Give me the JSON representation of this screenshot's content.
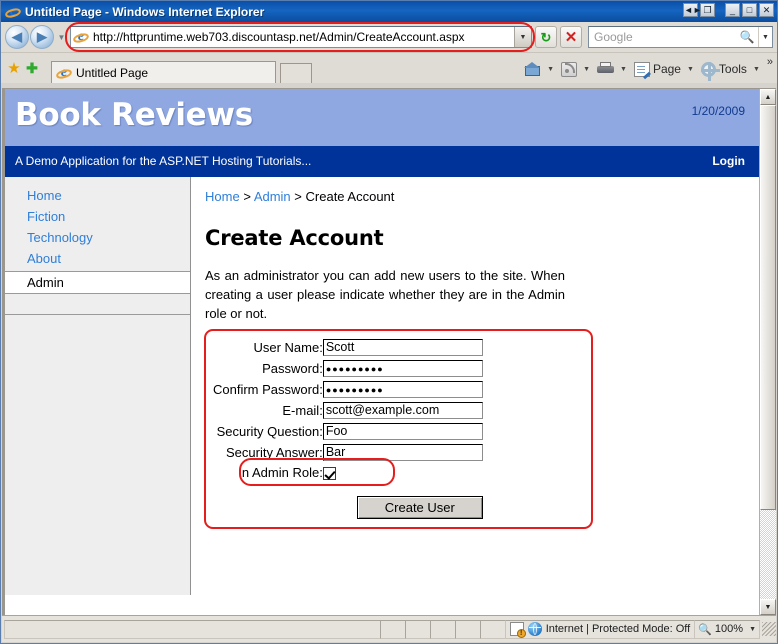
{
  "window": {
    "title": "Untitled Page - Windows Internet Explorer",
    "app_icon": "ie-logo-icon",
    "buttons": {
      "restore_small": "◄►",
      "restore_down": "❐",
      "minimize": "_",
      "maximize": "□",
      "close": "✕"
    }
  },
  "navbar": {
    "back_label": "◀",
    "forward_label": "▶",
    "history_arrow": "▼",
    "address_value": "http://httpruntime.web703.discountasp.net/Admin/CreateAccount.aspx",
    "address_dropdown": "▼",
    "refresh_label": "↻",
    "stop_label": "✕",
    "search_placeholder": "Google",
    "search_go": "🔍",
    "search_dropdown": "▼"
  },
  "tabbar": {
    "favorites_star": "★",
    "add_favorite": "✚",
    "tab_label": "Untitled Page",
    "new_tab_label": "",
    "commands": [
      {
        "name": "home",
        "label": "",
        "arrow": "▼"
      },
      {
        "name": "feeds",
        "label": "",
        "arrow": "▼"
      },
      {
        "name": "print",
        "label": "",
        "arrow": "▼"
      },
      {
        "name": "page",
        "label": "Page",
        "arrow": "▼"
      },
      {
        "name": "tools",
        "label": "Tools",
        "arrow": "▼"
      }
    ],
    "overflow": "»"
  },
  "site": {
    "title": "Book Reviews",
    "date": "1/20/2009",
    "subtitle": "A Demo Application for the ASP.NET Hosting Tutorials...",
    "login": "Login",
    "header_bg": "#8fa8e2",
    "subheader_bg": "#003399",
    "link_color": "#2f7fd8"
  },
  "sidebar": {
    "items": [
      {
        "label": "Home",
        "selected": false
      },
      {
        "label": "Fiction",
        "selected": false
      },
      {
        "label": "Technology",
        "selected": false
      },
      {
        "label": "About",
        "selected": false
      },
      {
        "label": "Admin",
        "selected": true
      }
    ]
  },
  "breadcrumb": {
    "home": "Home",
    "sep1": ">",
    "admin": "Admin",
    "sep2": ">",
    "current": "Create Account"
  },
  "page": {
    "heading": "Create Account",
    "description": "As an administrator you can add new users to the site. When creating a user please indicate whether they are in the Admin role or not."
  },
  "form": {
    "fields": [
      {
        "label": "User Name:",
        "value": "Scott",
        "type": "text"
      },
      {
        "label": "Password:",
        "value": "●●●●●●●●●",
        "type": "password"
      },
      {
        "label": "Confirm Password:",
        "value": "●●●●●●●●●",
        "type": "password"
      },
      {
        "label": "E-mail:",
        "value": "scott@example.com",
        "type": "text"
      },
      {
        "label": "Security Question:",
        "value": "Foo",
        "type": "text"
      },
      {
        "label": "Security Answer:",
        "value": "Bar",
        "type": "text"
      }
    ],
    "checkbox_label": "In Admin Role:",
    "checkbox_checked": true,
    "submit_label": "Create User",
    "annotation_color": "#e51d1d"
  },
  "statusbar": {
    "zone_text": "Internet | Protected Mode: Off",
    "zoom_level": "100%",
    "zoom_arrow": "▼"
  }
}
